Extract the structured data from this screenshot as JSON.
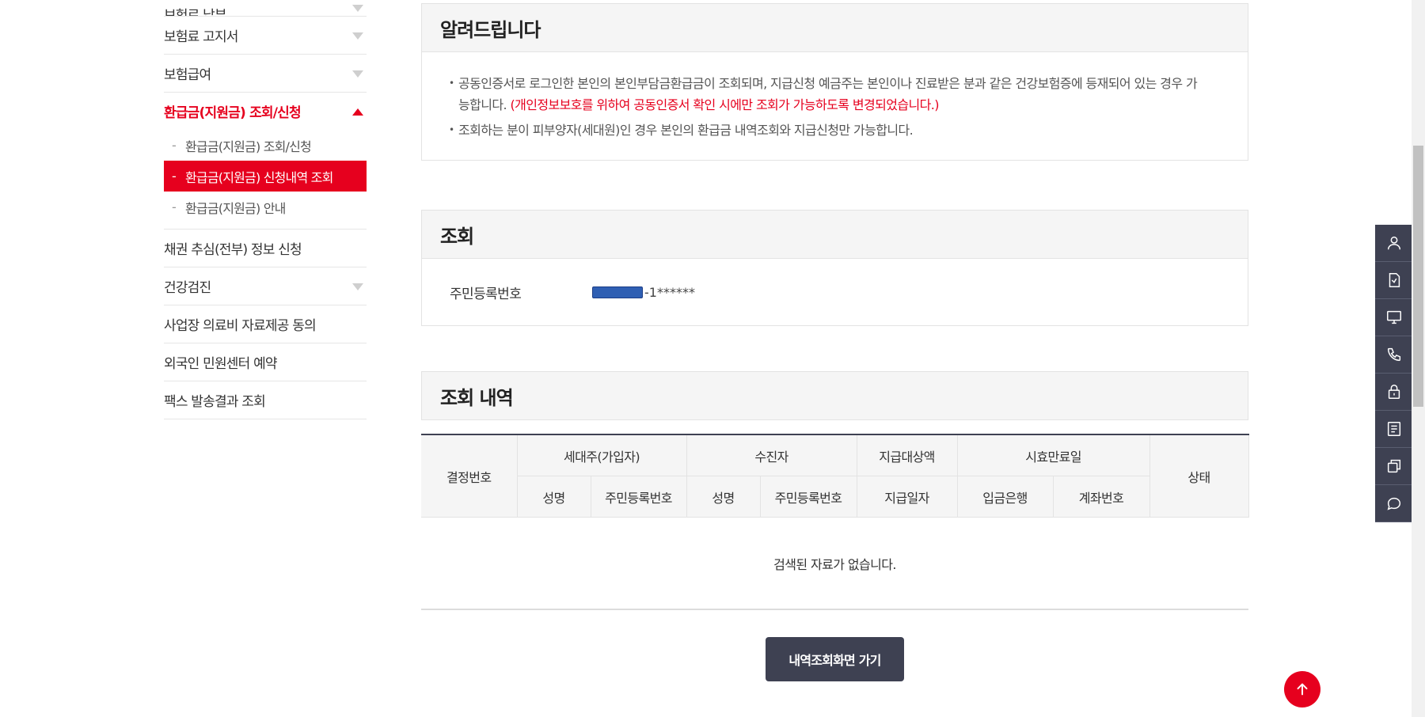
{
  "sidebar": {
    "top_cut_item": "보험료 납부",
    "items_before": [
      {
        "label": "보험료 고지서"
      },
      {
        "label": "보험급여"
      }
    ],
    "active": {
      "label": "환급금(지원금) 조회/신청",
      "sub_items": [
        {
          "label": "환급금(지원금) 조회/신청"
        },
        {
          "label": "환급금(지원금) 신청내역 조회"
        },
        {
          "label": "환급금(지원금) 안내"
        }
      ]
    },
    "items_after": [
      {
        "label": "채권 추심(전부) 정보 신청"
      },
      {
        "label": "건강검진"
      },
      {
        "label": "사업장 의료비 자료제공 동의"
      },
      {
        "label": "외국인 민원센터 예약"
      },
      {
        "label": "팩스 발송결과 조회"
      }
    ],
    "dash": "-"
  },
  "notice": {
    "title": "알려드립니다",
    "item1_text": "공동인증서로 로그인한 본인의 본인부담금환급금이 조회되며, 지급신청 예금주는 본인이나 진료받은 분과 같은 건강보험증에 등재되어 있는 경우 가능합니다.",
    "item1_red": "(개인정보보호를 위하여 공동인증서 확인 시에만 조회가 가능하도록 변경되었습니다.)",
    "item2_text": "조회하는 분이 피부양자(세대원)인 경우 본인의 환급금 내역조회와 지급신청만 가능합니다."
  },
  "query": {
    "title": "조회",
    "label": "주민등록번호",
    "value_suffix": "-1******"
  },
  "results": {
    "title": "조회 내역",
    "headers": {
      "decision_no": "결정번호",
      "householder": "세대주(가입자)",
      "recipient": "수진자",
      "payment_target": "지급대상액",
      "expiry": "시효만료일",
      "status": "상태",
      "hh_name": "성명",
      "hh_rrn": "주민등록번호",
      "rc_name": "성명",
      "rc_rrn": "주민등록번호",
      "pay_date": "지급일자",
      "bank": "입금은행",
      "account": "계좌번호"
    },
    "empty_message": "검색된 자료가 없습니다.",
    "button_label": "내역조회화면 가기"
  },
  "quickbar": {
    "icons": [
      "user-icon",
      "document-icon",
      "monitor-icon",
      "phone-icon",
      "lock-icon",
      "list-icon",
      "copy-icon",
      "chat-icon"
    ]
  },
  "colors": {
    "accent": "#e6001e",
    "dark": "#3e4152"
  }
}
